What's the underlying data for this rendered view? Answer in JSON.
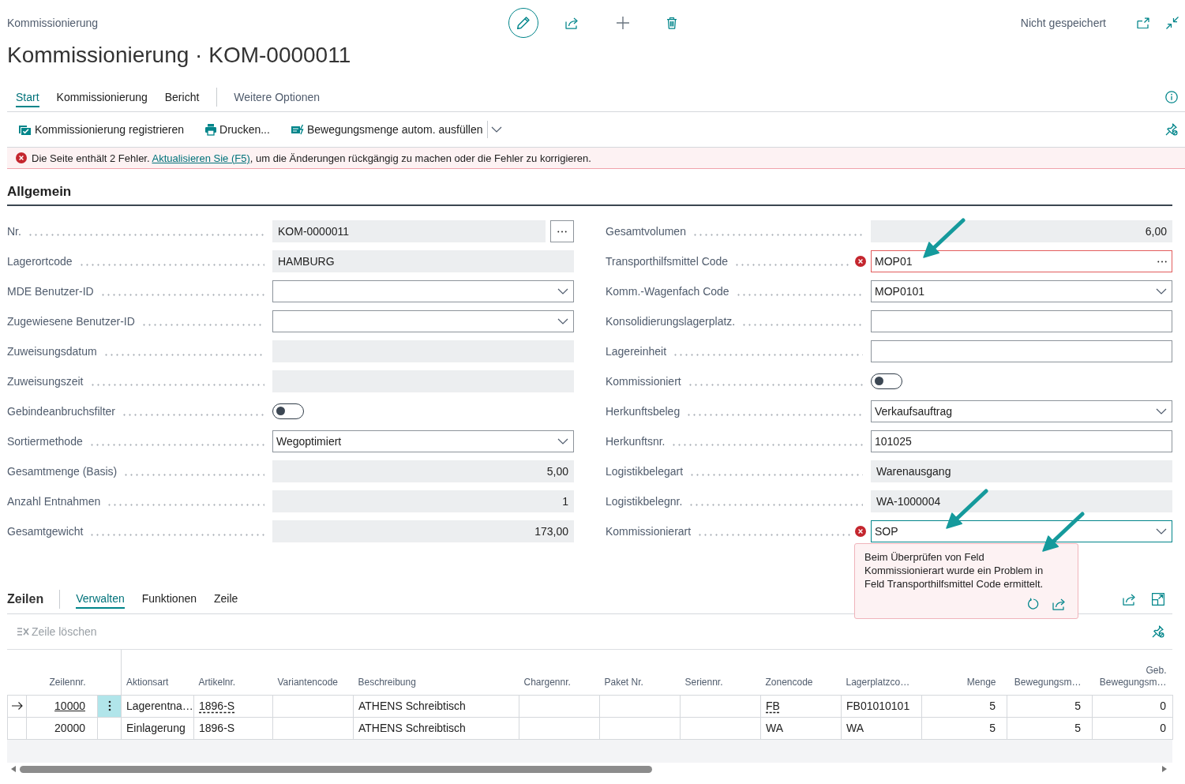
{
  "header": {
    "breadcrumb": "Kommissionierung",
    "title": "Kommissionierung · KOM-0000011",
    "save_status": "Nicht gespeichert"
  },
  "tabs": [
    {
      "label": "Start",
      "selected": true
    },
    {
      "label": "Kommissionierung",
      "selected": false
    },
    {
      "label": "Bericht",
      "selected": false
    }
  ],
  "more_options": "Weitere Optionen",
  "actions": [
    {
      "label": "Kommissionierung registrieren"
    },
    {
      "label": "Drucken..."
    },
    {
      "label": "Bewegungsmenge autom. ausfüllen"
    }
  ],
  "error_bar": {
    "text_before": "Die Seite enthält 2 Fehler. ",
    "link": "Aktualisieren Sie (F5)",
    "text_after": ", um die Änderungen rückgängig zu machen oder die Fehler zu korrigieren."
  },
  "general": {
    "title": "Allgemein",
    "left_fields": [
      {
        "label": "Nr.",
        "kind": "assist",
        "value": "KOM-0000011",
        "error": false,
        "focused": false
      },
      {
        "label": "Lagerortcode",
        "kind": "readonly",
        "value": "HAMBURG",
        "error": false,
        "focused": false
      },
      {
        "label": "MDE Benutzer-ID",
        "kind": "dropdown",
        "error": false,
        "focused": false
      },
      {
        "label": "Zugewiesene Benutzer-ID",
        "kind": "dropdown",
        "error": false,
        "focused": false
      },
      {
        "label": "Zuweisungsdatum",
        "kind": "readonly",
        "error": false,
        "focused": false
      },
      {
        "label": "Zuweisungszeit",
        "kind": "readonly",
        "error": false,
        "focused": false
      },
      {
        "label": "Gebindeanbruchsfilter",
        "kind": "toggle",
        "on": false,
        "error": false,
        "focused": false
      },
      {
        "label": "Sortiermethode",
        "kind": "dropdown",
        "value": "Wegoptimiert",
        "error": false,
        "focused": false
      },
      {
        "label": "Gesamtmenge (Basis)",
        "kind": "number",
        "value": "5,00",
        "error": false,
        "focused": false
      },
      {
        "label": "Anzahl Entnahmen",
        "kind": "number",
        "value": "1",
        "error": false,
        "focused": false
      },
      {
        "label": "Gesamtgewicht",
        "kind": "number",
        "value": "173,00",
        "error": false,
        "focused": false
      }
    ],
    "right_fields": [
      {
        "label": "Gesamtvolumen",
        "kind": "number",
        "value": "6,00",
        "error": false,
        "focused": false
      },
      {
        "label": "Transporthilfsmittel Code",
        "kind": "lookup",
        "value": "MOP01",
        "error": true,
        "focused": false
      },
      {
        "label": "Komm.-Wagenfach Code",
        "kind": "dropdown",
        "value": "MOP0101",
        "error": false,
        "focused": false
      },
      {
        "label": "Konsolidierungslagerplatz.",
        "kind": "text",
        "error": false,
        "focused": false
      },
      {
        "label": "Lagereinheit",
        "kind": "text",
        "error": false,
        "focused": false
      },
      {
        "label": "Kommissioniert",
        "kind": "toggle",
        "on": false,
        "error": false,
        "focused": false
      },
      {
        "label": "Herkunftsbeleg",
        "kind": "dropdown",
        "value": "Verkaufsauftrag",
        "error": false,
        "focused": false
      },
      {
        "label": "Herkunftsnr.",
        "kind": "text",
        "value": "101025",
        "error": false,
        "focused": false
      },
      {
        "label": "Logistikbelegart",
        "kind": "readonly",
        "value": "Warenausgang",
        "error": false,
        "focused": false
      },
      {
        "label": "Logistikbelegnr.",
        "kind": "readonly",
        "value": "WA-1000004",
        "error": false,
        "focused": false
      },
      {
        "label": "Kommissionierart",
        "kind": "dropdown",
        "value": "SOP",
        "error": true,
        "focused": true,
        "error_popup": {
          "message": "Beim Überprüfen von Feld Kommissionierart wurde ein Problem in Feld Transporthilfsmittel Code ermittelt."
        }
      }
    ]
  },
  "lines": {
    "title": "Zeilen",
    "tabs": [
      {
        "label": "Verwalten",
        "selected": true
      },
      {
        "label": "Funktionen",
        "selected": false
      },
      {
        "label": "Zeile",
        "selected": false
      }
    ],
    "actions": [
      {
        "label": "Zeile löschen",
        "disabled": true
      }
    ],
    "table": {
      "columns": [
        {
          "label": "Zeilennr.",
          "kind": "key"
        },
        {
          "label": "Aktionsart",
          "kind": "text"
        },
        {
          "label": "Artikelnr.",
          "kind": "lookup"
        },
        {
          "label": "Variantencode",
          "kind": "text"
        },
        {
          "label": "Beschreibung",
          "kind": "text"
        },
        {
          "label": "Chargennr.",
          "kind": "text"
        },
        {
          "label": "Paket Nr.",
          "kind": "text"
        },
        {
          "label": "Seriennr.",
          "kind": "text"
        },
        {
          "label": "Zonencode",
          "kind": "lookup"
        },
        {
          "label": "Lagerplatzco…",
          "kind": "text"
        },
        {
          "label": "Menge",
          "kind": "number"
        },
        {
          "label": "Bewegungsm…",
          "kind": "number"
        },
        {
          "label": "Geb. Bewegungsm…",
          "kind": "number"
        }
      ],
      "rows": [
        {
          "selected": true,
          "cells": [
            "10000",
            "Lagerentna…",
            "1896-S",
            null,
            "ATHENS Schreibtisch",
            null,
            null,
            null,
            "FB",
            "FB01010101",
            "5",
            "5",
            "0"
          ]
        },
        {
          "selected": false,
          "cells": [
            "20000",
            "Einlagerung",
            "1896-S",
            null,
            "ATHENS Schreibtisch",
            null,
            null,
            null,
            "WA",
            "WA",
            "5",
            "5",
            "0"
          ]
        }
      ]
    }
  }
}
